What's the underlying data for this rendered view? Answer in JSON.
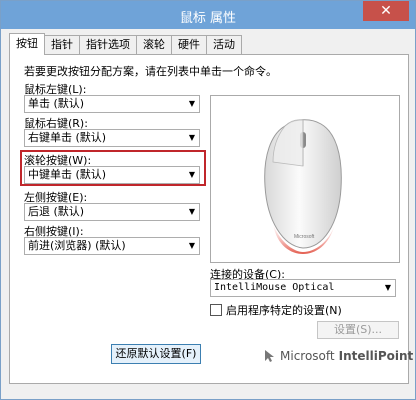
{
  "window": {
    "title": "鼠标 属性",
    "close_glyph": "✕"
  },
  "tabs": [
    {
      "label": "按钮",
      "active": true
    },
    {
      "label": "指针",
      "active": false
    },
    {
      "label": "指针选项",
      "active": false
    },
    {
      "label": "滚轮",
      "active": false
    },
    {
      "label": "硬件",
      "active": false
    },
    {
      "label": "活动",
      "active": false
    }
  ],
  "buttons_panel": {
    "instruction": "若要更改按钮分配方案，请在列表中单击一个命令。",
    "left_button": {
      "label": "鼠标左键(L):",
      "value": "单击 (默认)"
    },
    "right_button": {
      "label": "鼠标右键(R):",
      "value": "右键单击 (默认)"
    },
    "wheel_button": {
      "label": "滚轮按键(W):",
      "value": "中键单击 (默认)"
    },
    "left_side": {
      "label": "左侧按键(E):",
      "value": "后退 (默认)"
    },
    "right_side": {
      "label": "右侧按键(I):",
      "value": "前进(浏览器) (默认)"
    },
    "highlight_color": "#c0262b"
  },
  "device": {
    "label": "连接的设备(C):",
    "value": "IntelliMouse Optical",
    "checkbox_label": "启用程序特定的设置(N)",
    "checkbox_checked": false,
    "settings_button": "设置(S)..."
  },
  "restore_button": "还原默认设置(F)",
  "brand": {
    "name_light": "Microsoft",
    "name_bold": "IntelliPoint"
  },
  "mouse_model_label": "Microsoft"
}
